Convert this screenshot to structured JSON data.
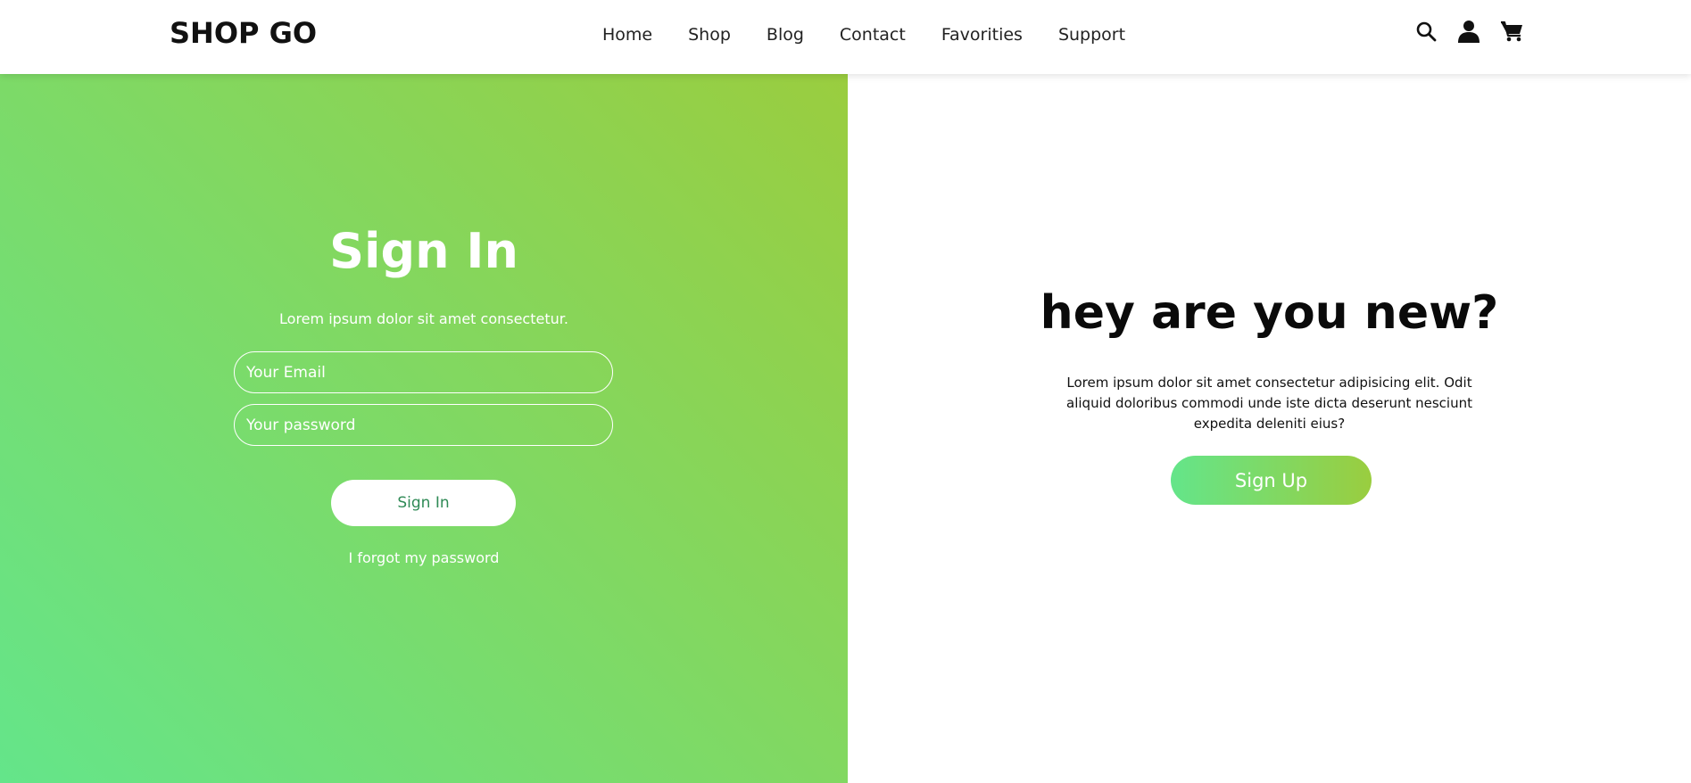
{
  "header": {
    "logo": "SHOP GO",
    "nav": [
      {
        "label": "Home"
      },
      {
        "label": "Shop"
      },
      {
        "label": "Blog"
      },
      {
        "label": "Contact"
      },
      {
        "label": "Favorities"
      },
      {
        "label": "Support"
      }
    ],
    "icons": [
      "search-icon",
      "user-icon",
      "cart-icon"
    ]
  },
  "signin": {
    "title": "Sign In",
    "subtitle": "Lorem ipsum dolor sit amet consectetur.",
    "email_placeholder": "Your Email",
    "email_value": "",
    "password_placeholder": "Your password",
    "password_value": "",
    "button_label": "Sign In",
    "forgot_label": "I forgot my password"
  },
  "signup": {
    "title": "hey are you new?",
    "text": "Lorem ipsum dolor sit amet consectetur adipisicing elit. Odit aliquid doloribus commodi unde iste dicta deserunt nesciunt expedita deleniti eius?",
    "button_label": "Sign Up"
  },
  "colors": {
    "gradient_start": "#64e58a",
    "gradient_end": "#9acd3f",
    "signin_button_text": "#2f8a56"
  }
}
